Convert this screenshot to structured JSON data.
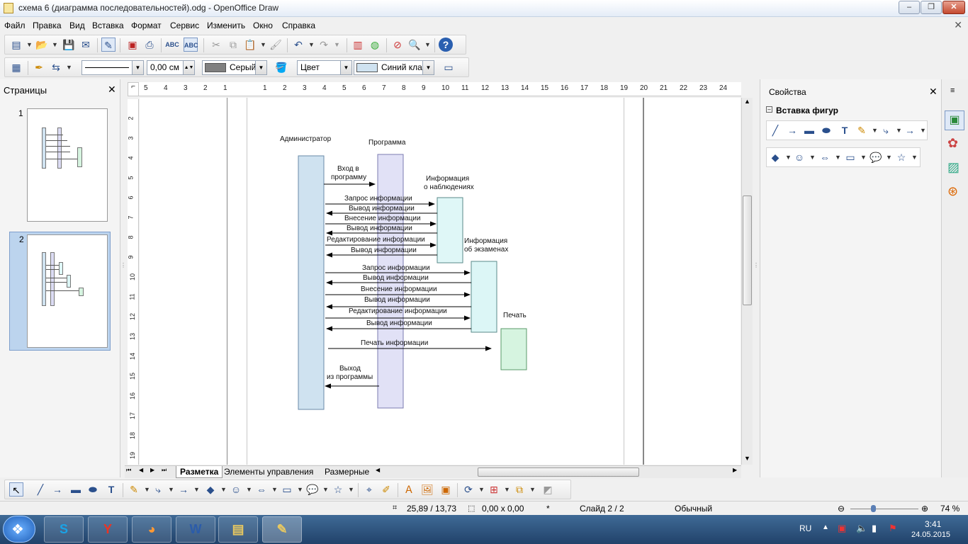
{
  "window": {
    "title": "схема 6 (диаграмма последовательностей).odg - OpenOffice Draw",
    "min_label": "–",
    "max_label": "❐",
    "close_label": "✕"
  },
  "menu": [
    "Файл",
    "Правка",
    "Вид",
    "Вставка",
    "Формат",
    "Сервис",
    "Изменить",
    "Окно",
    "Справка"
  ],
  "toolbar2": {
    "line_width": "0,00 см",
    "line_color": "Серый",
    "area_style": "Цвет",
    "area_color": "Синий кла"
  },
  "pages_panel": {
    "title": "Страницы",
    "pages": [
      {
        "number": "1"
      },
      {
        "number": "2"
      }
    ]
  },
  "ruler": {
    "h_labels": [
      "5",
      "4",
      "3",
      "2",
      "1",
      "",
      "1",
      "2",
      "3",
      "4",
      "5",
      "6",
      "7",
      "8",
      "9",
      "10",
      "11",
      "12",
      "13",
      "14",
      "15",
      "16",
      "17",
      "18",
      "19",
      "20",
      "21",
      "22",
      "23",
      "24"
    ],
    "v_labels": [
      "2",
      "3",
      "4",
      "5",
      "6",
      "7",
      "8",
      "9",
      "10",
      "11",
      "12",
      "13",
      "14",
      "15",
      "16",
      "17",
      "18",
      "19"
    ]
  },
  "diagram": {
    "actors": {
      "admin": "Администратор",
      "program": "Программа",
      "observations": [
        "Информация",
        "о наблюдениях"
      ],
      "exams": [
        "Информация",
        "об экзаменах"
      ],
      "print": "Печать"
    },
    "messages": {
      "login": [
        "Вход в",
        "программу"
      ],
      "obs": [
        "Запрос информации",
        "Вывод информации",
        "Внесение информации",
        "Вывод информации",
        "Редактирование информации",
        "Вывод информации"
      ],
      "exam": [
        "Запрос информации",
        "Вывод информации",
        "Внесение информации",
        "Вывод информации",
        "Редактирование информации",
        "Вывод информации"
      ],
      "print_msg": "Печать информации",
      "exit": [
        "Выход",
        "из программы"
      ]
    }
  },
  "tabs": [
    "Разметка",
    "Элементы управления",
    "Размерные"
  ],
  "sidebar": {
    "title": "Свойства",
    "section": "Вставка фигур"
  },
  "status": {
    "position": "25,89 / 13,73",
    "size": "0,00 x 0,00",
    "modified": "*",
    "slide": "Слайд 2 / 2",
    "style": "Обычный",
    "zoom": "74 %"
  },
  "taskbar": {
    "lang": "RU",
    "time": "3:41",
    "date": "24.05.2015"
  },
  "colors": {
    "admin_lifeline": "#cfe2f0",
    "program_lifeline": "#dcdcf4",
    "obs_box": "#dff7f7",
    "exam_box": "#dcf6f6",
    "print_box": "#d6f4e0"
  }
}
